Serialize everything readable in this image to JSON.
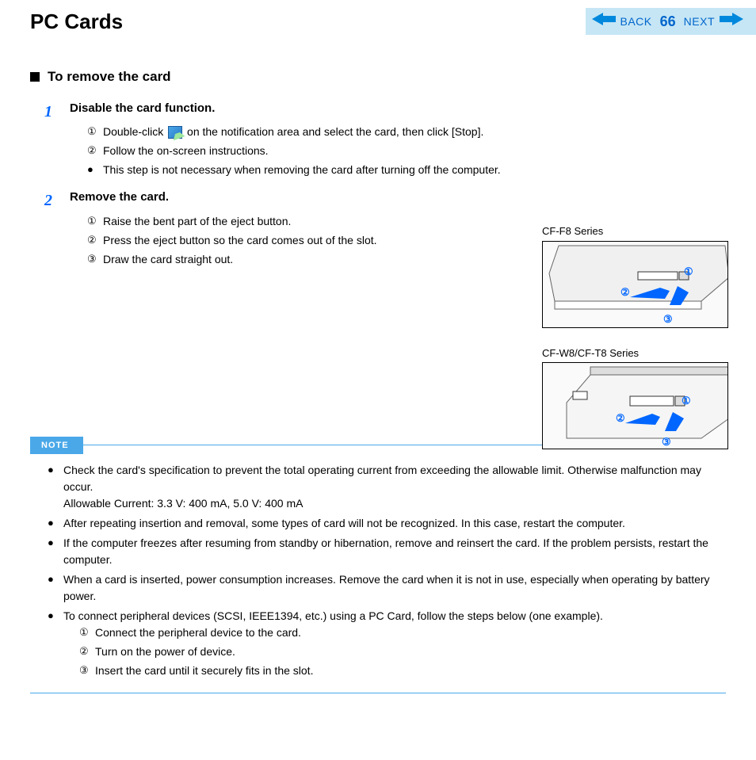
{
  "header": {
    "title": "PC Cards",
    "back": "BACK",
    "page": "66",
    "next": "NEXT"
  },
  "section": {
    "heading": "To remove the card"
  },
  "steps": [
    {
      "num": "1",
      "title": "Disable the card function.",
      "items": [
        {
          "marker": "①",
          "pre": "Double-click ",
          "post": " on the notification area and select the card, then click [Stop]."
        },
        {
          "marker": "②",
          "text": "Follow the on-screen instructions."
        },
        {
          "marker": "●",
          "text": "This step is not necessary when removing the card after turning off the computer."
        }
      ]
    },
    {
      "num": "2",
      "title": "Remove the card.",
      "items": [
        {
          "marker": "①",
          "text": "Raise the bent part of the eject button."
        },
        {
          "marker": "②",
          "text": "Press the eject button so the card comes out of the slot."
        },
        {
          "marker": "③",
          "text": "Draw the card straight out."
        }
      ]
    }
  ],
  "figures": [
    {
      "label": "CF-F8 Series"
    },
    {
      "label": "CF-W8/CF-T8 Series"
    }
  ],
  "callouts": {
    "c1": "①",
    "c2": "②",
    "c3": "③"
  },
  "noteLabel": "NOTE",
  "notes": [
    {
      "text": "Check the card's specification to prevent the total operating current from exceeding the allowable limit. Otherwise malfunction may occur.",
      "line2": "Allowable Current: 3.3 V: 400 mA, 5.0 V: 400 mA"
    },
    {
      "text": "After repeating insertion and removal, some types of card will not be recognized. In this case, restart the computer."
    },
    {
      "text": "If the computer freezes after resuming from standby or hibernation, remove and reinsert the card. If the problem persists, restart the computer."
    },
    {
      "text": "When a card is inserted, power consumption increases. Remove the card when it is not in use, especially when operating by battery power."
    },
    {
      "text": "To connect peripheral devices (SCSI, IEEE1394, etc.) using a PC Card, follow the steps below (one example).",
      "nested": [
        {
          "marker": "①",
          "text": "Connect the peripheral device to the card."
        },
        {
          "marker": "②",
          "text": "Turn on the power of device."
        },
        {
          "marker": "③",
          "text": "Insert the card until it securely fits in the slot."
        }
      ]
    }
  ]
}
